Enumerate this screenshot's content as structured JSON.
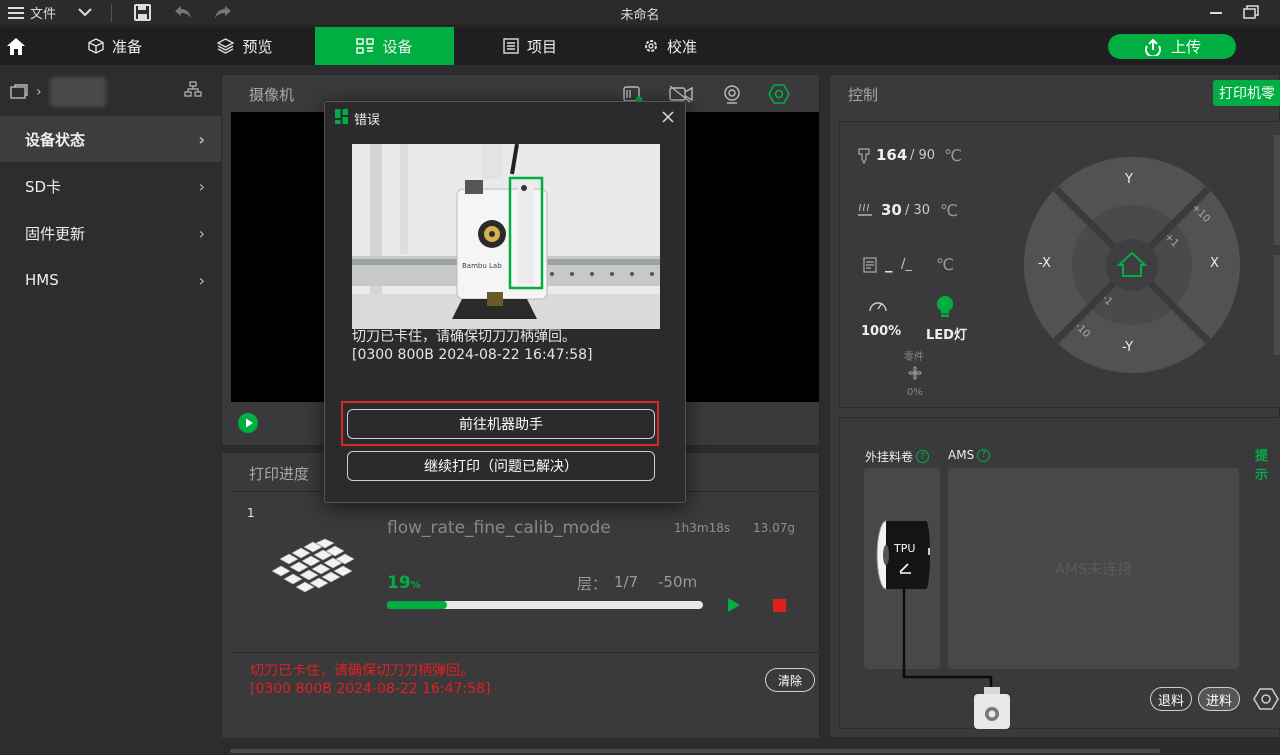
{
  "window": {
    "title": "未命名",
    "file_menu": "文件"
  },
  "tabs": [
    {
      "label": "准备",
      "icon": "cube-icon"
    },
    {
      "label": "预览",
      "icon": "layers-icon"
    },
    {
      "label": "设备",
      "icon": "device-icon",
      "active": true
    },
    {
      "label": "项目",
      "icon": "list-icon"
    },
    {
      "label": "校准",
      "icon": "gear-icon"
    }
  ],
  "upload_label": "上传",
  "sidebar": {
    "items": [
      {
        "label": "设备状态",
        "active": true
      },
      {
        "label": "SD卡"
      },
      {
        "label": "固件更新"
      },
      {
        "label": "HMS"
      }
    ]
  },
  "camera": {
    "title": "摄像机"
  },
  "progress": {
    "title": "打印进度",
    "plate": "1",
    "file_name": "flow_rate_fine_calib_mode",
    "time": "1h3m18s",
    "weight": "13.07g",
    "percent_value": "19",
    "percent_unit": "%",
    "percent_fraction": 0.19,
    "layer_label": "层：",
    "layer_value": "1/7",
    "remaining": "-50m",
    "error_line1": "切刀已卡住，请确保切刀刀柄弹回。",
    "error_line2": "[0300 800B 2024-08-22 16:47:58]",
    "clear_label": "清除"
  },
  "control": {
    "title": "控制",
    "print_part_btn": "打印机零",
    "nozzle_temp": "164",
    "nozzle_target": "/ 90",
    "bed_temp": "30",
    "bed_target": "/ 30",
    "chamber_temp": "_",
    "chamber_target": "/_",
    "unit": "℃",
    "speed": "100%",
    "led": "LED灯",
    "part_fan_label": "零件",
    "part_fan_value": "0%",
    "jog": {
      "y_up": "Y",
      "y_down": "-Y",
      "x_left": "-X",
      "x_right": "X",
      "p10": "+10",
      "p1": "+1",
      "m1": "-1",
      "m10": "-10"
    },
    "ext_spool_label": "外挂料卷",
    "ams_label": "AMS",
    "hint_label": "提示",
    "tpu_label": "TPU",
    "ams_status": "AMS未连接",
    "unload_label": "退料",
    "load_label": "进料"
  },
  "dialog": {
    "title": "错误",
    "message": "切刀已卡住，请确保切刀刀柄弹回。",
    "code": "[0300 800B 2024-08-22 16:47:58]",
    "btn_assistant": "前往机器助手",
    "btn_resume": "继续打印（问题已解决）",
    "image_brand_text": "Bambu Lab"
  },
  "colors": {
    "accent": "#00ae42",
    "error": "#e0201e",
    "highlight_box": "#d42a2a"
  }
}
